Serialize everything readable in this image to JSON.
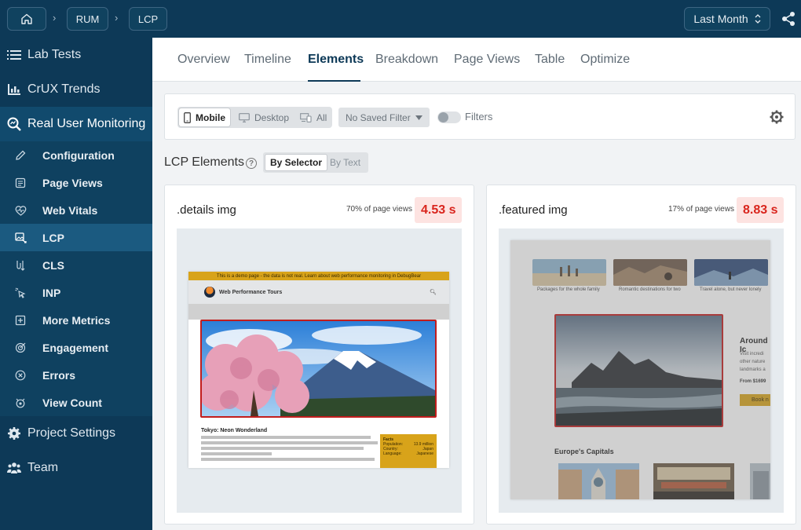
{
  "topbar": {
    "breadcrumbs": [
      "RUM",
      "LCP"
    ],
    "date_range": "Last Month"
  },
  "sidebar": {
    "items": [
      {
        "label": "Lab Tests",
        "icon": "list-icon"
      },
      {
        "label": "CrUX Trends",
        "icon": "bar-chart-icon"
      },
      {
        "label": "Real User Monitoring",
        "icon": "search-chart-icon",
        "active": true
      }
    ],
    "sub_items": [
      {
        "label": "Configuration",
        "icon": "pencil-icon"
      },
      {
        "label": "Page Views",
        "icon": "document-icon"
      },
      {
        "label": "Web Vitals",
        "icon": "heart-pulse-icon"
      },
      {
        "label": "LCP",
        "icon": "image-icon",
        "active": true
      },
      {
        "label": "CLS",
        "icon": "layout-shift-icon"
      },
      {
        "label": "INP",
        "icon": "pointer-icon"
      },
      {
        "label": "More Metrics",
        "icon": "plus-box-icon"
      },
      {
        "label": "Engagement",
        "icon": "target-icon"
      },
      {
        "label": "Errors",
        "icon": "x-circle-icon"
      },
      {
        "label": "View Count",
        "icon": "eye-icon"
      }
    ],
    "bottom_items": [
      {
        "label": "Project Settings",
        "icon": "gear-icon"
      },
      {
        "label": "Team",
        "icon": "users-icon"
      }
    ]
  },
  "tabs": [
    "Overview",
    "Timeline",
    "Elements",
    "Breakdown",
    "Page Views",
    "Table",
    "Optimize"
  ],
  "active_tab": "Elements",
  "filters": {
    "devices": [
      "Mobile",
      "Desktop",
      "All"
    ],
    "active_device": "Mobile",
    "saved_filter": "No Saved Filter",
    "filters_label": "Filters"
  },
  "lcp": {
    "title": "LCP Elements",
    "modes": [
      "By Selector",
      "By Text"
    ],
    "active_mode": "By Selector"
  },
  "cards": [
    {
      "selector": ".details img",
      "share": "70% of page views",
      "time": "4.53 s",
      "preview": {
        "banner": "This is a demo page - the data is not real. Learn about web performance monitoring in DebugBear",
        "site": "Web Performance Tours",
        "heading": "Tokyo: Neon Wonderland",
        "facts_title": "Facts",
        "facts": [
          "Population:",
          "13.9 million",
          "Country:",
          "Japan",
          "Language:",
          "Japanese"
        ]
      }
    },
    {
      "selector": ".featured img",
      "share": "17% of page views",
      "time": "8.83 s",
      "preview": {
        "captions": [
          "Packages for the whole family",
          "Romantic destinations for two",
          "Travel alone, but never lonely"
        ],
        "side_title": "Around Ic",
        "side_lines": [
          "Visit incredi",
          "other nature",
          "landmarks a"
        ],
        "price": "From $1699",
        "book": "Book n",
        "section": "Europe's Capitals"
      }
    }
  ],
  "colors": {
    "nav": "#0d3957",
    "danger_text": "#d9251d",
    "danger_bg": "#fde3e1",
    "highlight_border": "#c21d1d",
    "accent_gold": "#d8a31a"
  }
}
